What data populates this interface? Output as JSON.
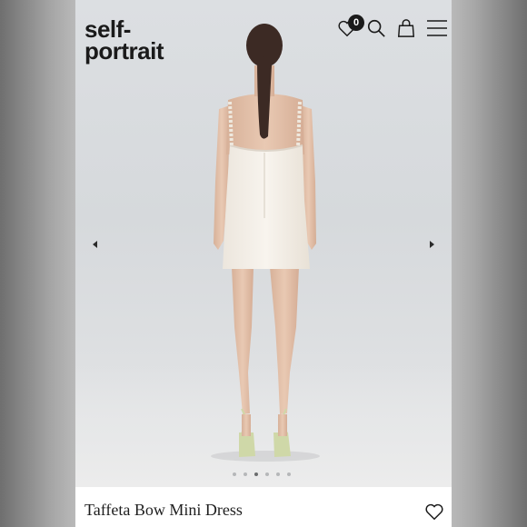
{
  "brand": {
    "line1": "self-",
    "line2": "portrait"
  },
  "header": {
    "wishlist_count": "0",
    "icons": [
      "heart-icon",
      "search-icon",
      "bag-icon",
      "menu-icon"
    ]
  },
  "gallery": {
    "image_count": 6,
    "active_index": 3,
    "subject": "model-back-view-white-mini-dress"
  },
  "product": {
    "title": "Taffeta Bow Mini Dress"
  },
  "colors": {
    "text": "#1a1a1a",
    "backdrop": "#dcdfe2",
    "dress": "#f4f0ea",
    "hair": "#3c2a24",
    "skin": "#e3c2ab",
    "sandal": "#cfd8a8"
  }
}
